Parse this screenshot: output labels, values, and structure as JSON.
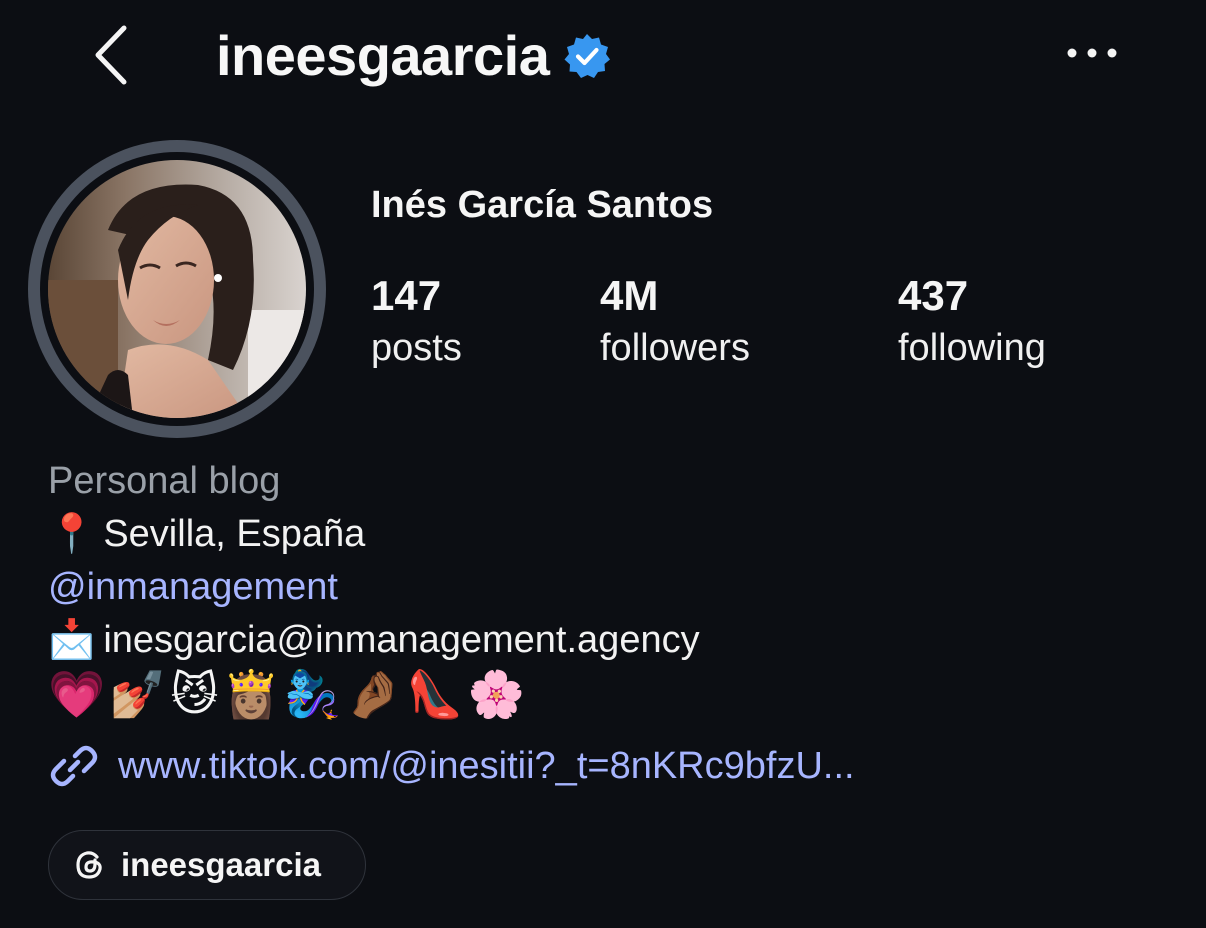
{
  "header": {
    "username": "ineesgaarcia",
    "verified_color": "#3897f0"
  },
  "profile": {
    "full_name": "Inés García Santos",
    "stats": [
      {
        "count": "147",
        "label": "posts"
      },
      {
        "count": "4M",
        "label": "followers"
      },
      {
        "count": "437",
        "label": "following"
      }
    ]
  },
  "bio": {
    "category": "Personal blog",
    "location_emoji": "📍",
    "location": "Sevilla, España",
    "mention": "@inmanagement",
    "email_emoji": "📩",
    "email": "inesgarcia@inmanagement.agency",
    "emojis": "💗💅🏼😼👸🏽🧞‍♀️🤌🏾👠🌸",
    "link": "www.tiktok.com/@inesitii?_t=8nKRc9bfzU..."
  },
  "threads": {
    "handle": "ineesgaarcia"
  },
  "colors": {
    "background": "#0c0e13",
    "link": "#a7b5ff",
    "muted": "#9aa0a8",
    "avatar_ring": "#4b525e"
  },
  "icons": [
    "back-chevron-icon",
    "verified-badge-icon",
    "more-options-icon",
    "link-chain-icon",
    "threads-logo-icon"
  ]
}
